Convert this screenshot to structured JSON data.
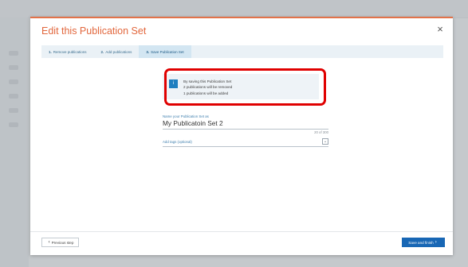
{
  "modal": {
    "title": "Edit this Publication Set",
    "close_glyph": "×"
  },
  "steps": [
    {
      "num": "1.",
      "label": "Remove publications"
    },
    {
      "num": "2.",
      "label": "Add publications"
    },
    {
      "num": "3.",
      "label": "Save Publication Set"
    }
  ],
  "info": {
    "icon_glyph": "i",
    "lines": [
      "By saving this Publication Set",
      "2 publications will be removed",
      "1 publications will be added"
    ]
  },
  "form": {
    "name_label": "Name your Publication Set as",
    "name_value": "My Publicatoin Set 2",
    "char_count": "20 of 300",
    "tags_label": "Add tags (optional)",
    "tags_toggle_glyph": "⌄"
  },
  "footer": {
    "prev_label": "Previous step",
    "prev_glyph": "‹",
    "next_label": "Save and finish",
    "next_glyph": "›"
  },
  "icons": {
    "close": "close-icon",
    "info": "info-icon",
    "chevron_down": "chevron-down-icon",
    "chevron_left": "chevron-left-icon",
    "chevron_right": "chevron-right-icon"
  },
  "colors": {
    "title": "#e2673d",
    "accent_border": "#e2724a",
    "primary_button": "#1867b5",
    "info_icon": "#1f7fc0",
    "highlight": "#e00000"
  }
}
